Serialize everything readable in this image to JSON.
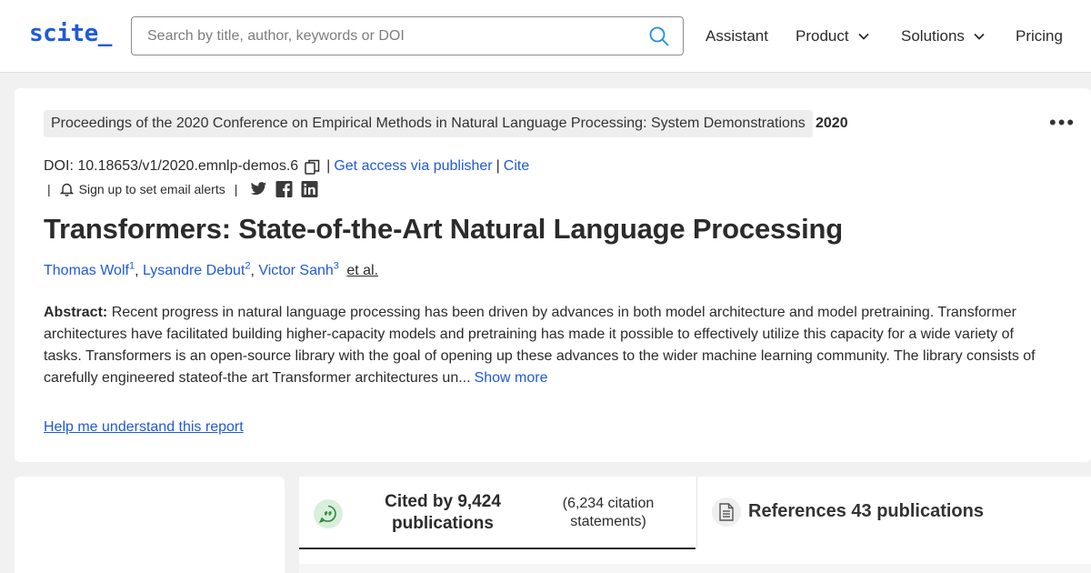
{
  "header": {
    "logo": "scite_",
    "search_placeholder": "Search by title, author, keywords or DOI",
    "nav": [
      {
        "label": "Assistant"
      },
      {
        "label": "Product"
      },
      {
        "label": "Solutions"
      },
      {
        "label": "Pricing"
      }
    ]
  },
  "paper": {
    "venue": "Proceedings of the 2020 Conference on Empirical Methods in Natural Language Processing: System Demonstrations",
    "year": "2020",
    "doi": "DOI: 10.18653/v1/2020.emnlp-demos.6",
    "access_link": "Get access via publisher",
    "cite_link": "Cite",
    "alerts_label": "Sign up to set email alerts",
    "title": "Transformers: State-of-the-Art Natural Language Processing",
    "authors": [
      {
        "name": "Thomas Wolf",
        "sup": "1"
      },
      {
        "name": "Lysandre Debut",
        "sup": "2"
      },
      {
        "name": "Victor Sanh",
        "sup": "3"
      }
    ],
    "et_al": "et al.",
    "abstract_label": "Abstract:",
    "abstract_text": "Recent progress in natural language processing has been driven by advances in both model architecture and model pretraining. Transformer architectures have facilitated building higher-capacity models and pretraining has made it possible to effectively utilize this capacity for a wide variety of tasks. Transformers is an open-source library with the goal of opening up these advances to the wider machine learning community. The library consists of carefully engineered stateof-the art Transformer architectures un...",
    "show_more": "Show more",
    "help_link": "Help me understand this report"
  },
  "tabs": {
    "cited_by": "Cited by 9,424 publications",
    "citation_statements": "(6,234 citation statements)",
    "references": "References 43 publications"
  },
  "icons": {
    "search": "search-icon",
    "copy": "copy-icon",
    "bell": "bell-icon",
    "twitter": "twitter-icon",
    "facebook": "facebook-icon",
    "linkedin": "linkedin-icon",
    "more": "more-dots-icon",
    "citation": "quote-bubble-icon",
    "references": "document-icon"
  },
  "colors": {
    "brand": "#1f5ad9",
    "text": "#2b2b2b",
    "background": "#f1f1f1",
    "citation_bubble": "#d9eedb",
    "citation_icon": "#2e8b3d"
  }
}
